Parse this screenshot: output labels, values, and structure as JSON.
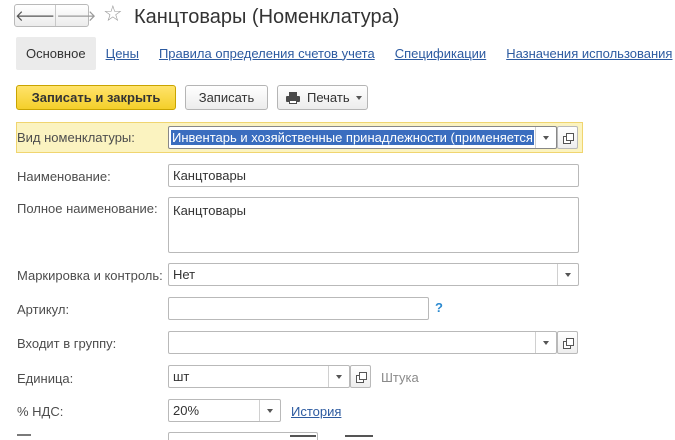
{
  "window": {
    "title": "Канцтовары (Номенклатура)"
  },
  "icons": {
    "back": "arrow-left-icon",
    "forward": "arrow-right-icon",
    "favorite": "star-icon",
    "print": "printer-icon",
    "open": "open-form-icon",
    "dropdown": "chevron-down-icon",
    "help": "question-icon"
  },
  "nav": {
    "back_glyph": "🡐",
    "forward_glyph": "🡒",
    "star_glyph": "☆"
  },
  "tabs": [
    {
      "label": "Основное",
      "active": true
    },
    {
      "label": "Цены"
    },
    {
      "label": "Правила определения счетов учета"
    },
    {
      "label": "Спецификации"
    },
    {
      "label": "Назначения использования"
    }
  ],
  "toolbar": {
    "save_close_label": "Записать и закрыть",
    "save_label": "Записать",
    "print_label": "Печать"
  },
  "form": {
    "kind": {
      "label": "Вид номенклатуры:",
      "value": "Инвентарь и хозяйственные принадлежности (применяется"
    },
    "name": {
      "label": "Наименование:",
      "value": "Канцтовары"
    },
    "full_name": {
      "label": "Полное наименование:",
      "value": "Канцтовары"
    },
    "marking": {
      "label": "Маркировка и контроль:",
      "value": "Нет"
    },
    "article": {
      "label": "Артикул:",
      "value": "",
      "help": "?"
    },
    "group": {
      "label": "Входит в группу:",
      "value": ""
    },
    "unit": {
      "label": "Единица:",
      "value": "шт",
      "description": "Штука"
    },
    "vat": {
      "label": "% НДС:",
      "value": "20%",
      "history_link": "История"
    }
  },
  "colors": {
    "accent_yellow": "#f4cf2a",
    "highlight_row": "#fbf3c0",
    "link_blue": "#2c5aa0",
    "selection_blue": "#3a6dbf"
  }
}
